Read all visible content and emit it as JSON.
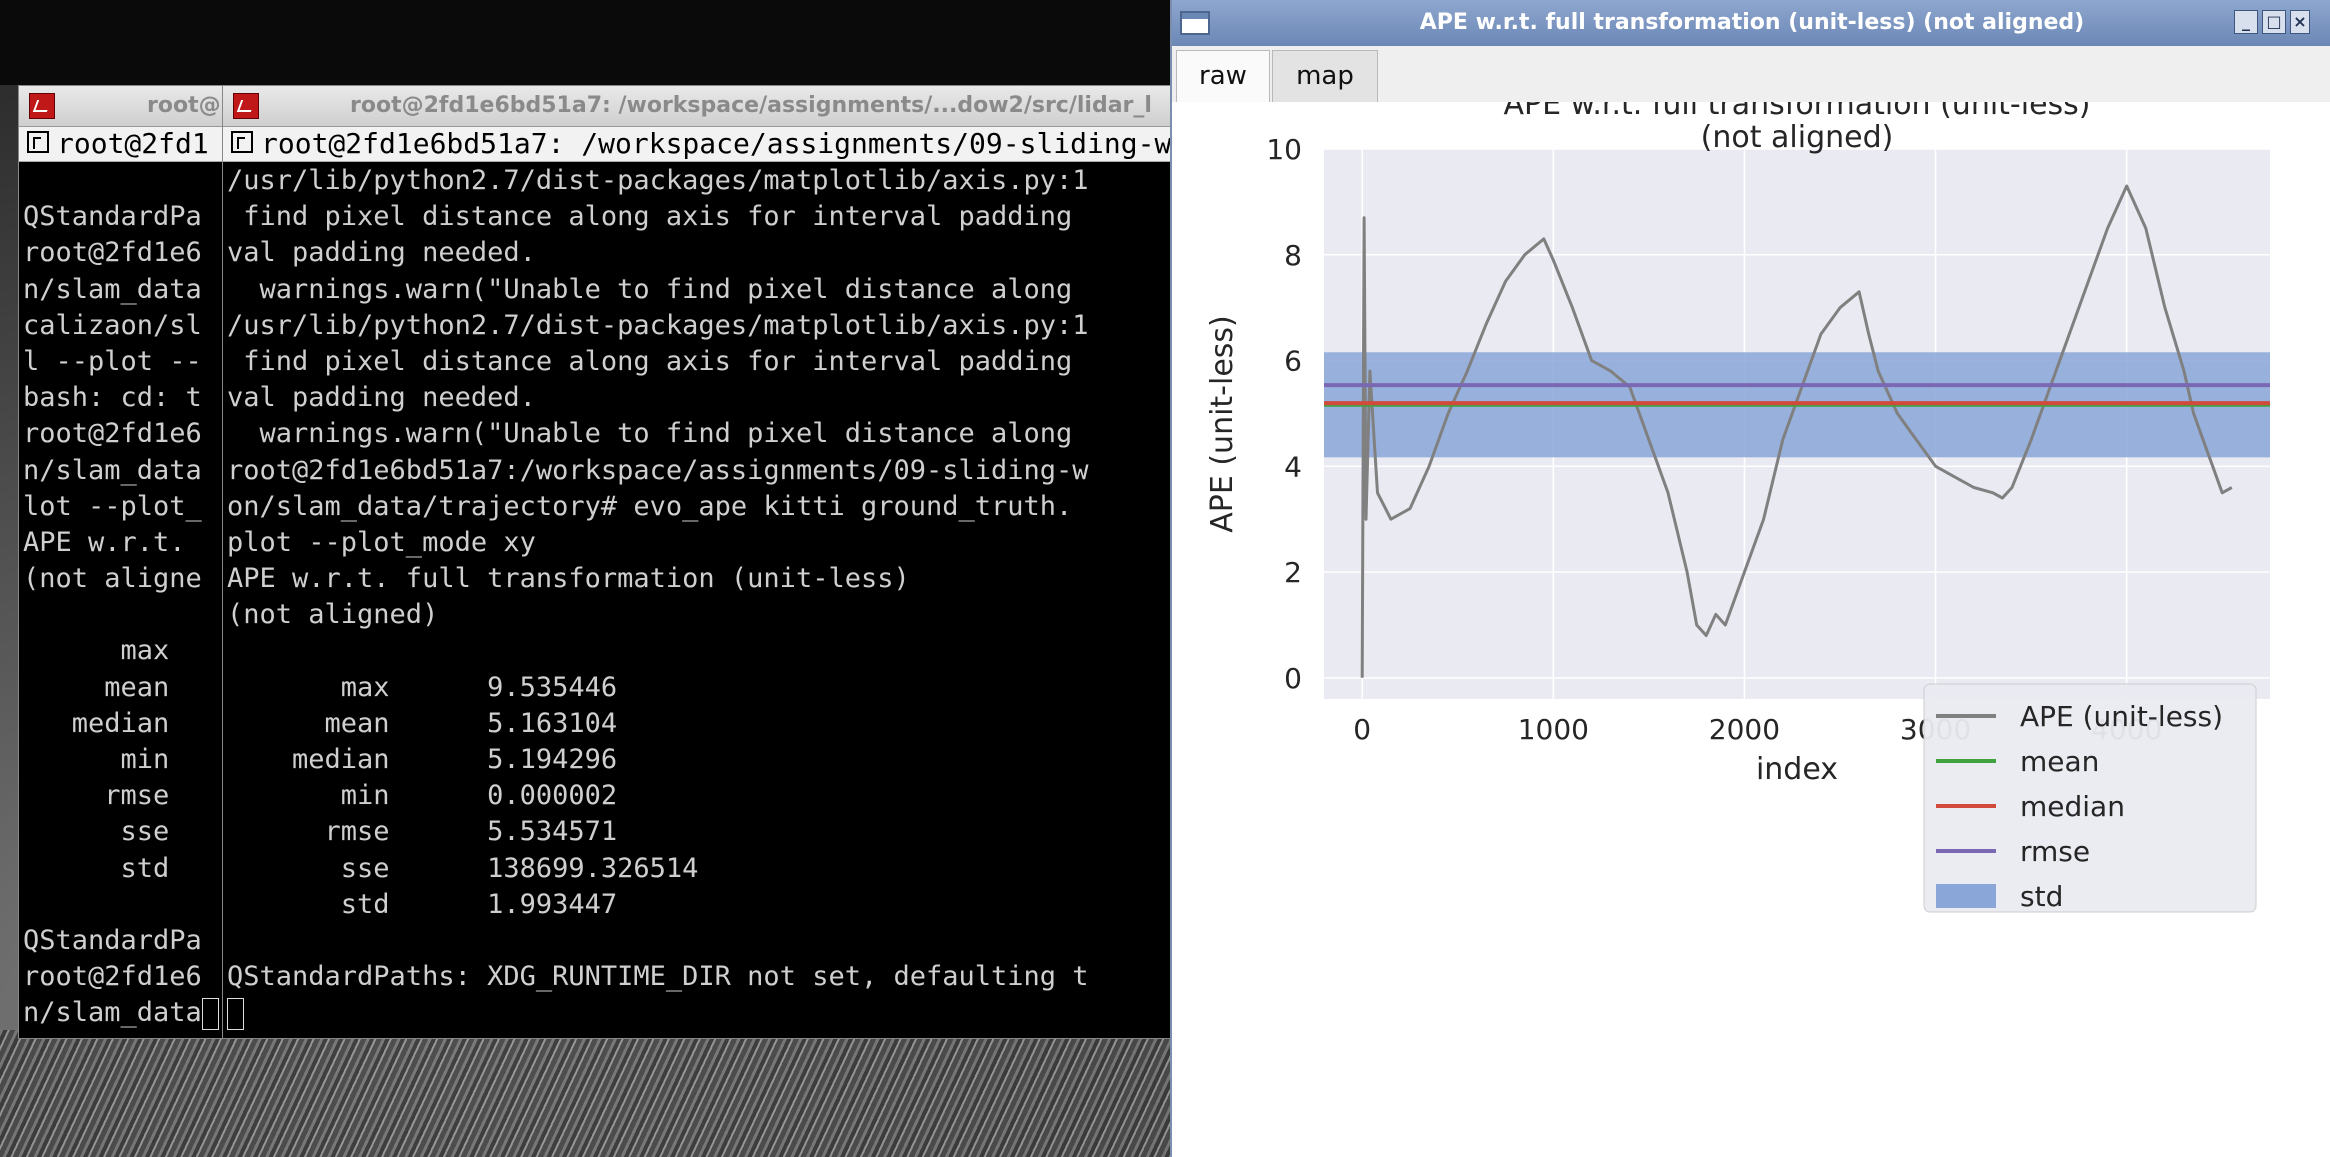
{
  "terminal_back": {
    "title": "root@",
    "tab_label": "root@2fd1",
    "lines": [
      "",
      "QStandardPa",
      "root@2fd1e6",
      "n/slam_data",
      "calizaon/sl",
      "l --plot --",
      "bash: cd: t",
      "root@2fd1e6",
      "n/slam_data",
      "lot --plot_",
      "APE w.r.t.",
      "(not aligne",
      "",
      "      max",
      "     mean",
      "   median",
      "      min",
      "     rmse",
      "      sse",
      "      std",
      "",
      "QStandardPa",
      "root@2fd1e6",
      "n/slam_data"
    ]
  },
  "terminal_front": {
    "title": "root@2fd1e6bd51a7: /workspace/assignments/...dow2/src/lidar_l",
    "tab_label": "root@2fd1e6bd51a7: /workspace/assignments/09-sliding-w",
    "lines": [
      "/usr/lib/python2.7/dist-packages/matplotlib/axis.py:1",
      " find pixel distance along axis for interval padding",
      "val padding needed.",
      "  warnings.warn(\"Unable to find pixel distance along",
      "/usr/lib/python2.7/dist-packages/matplotlib/axis.py:1",
      " find pixel distance along axis for interval padding",
      "val padding needed.",
      "  warnings.warn(\"Unable to find pixel distance along",
      "root@2fd1e6bd51a7:/workspace/assignments/09-sliding-w",
      "on/slam_data/trajectory# evo_ape kitti ground_truth.",
      "plot --plot_mode xy",
      "APE w.r.t. full transformation (unit-less)",
      "(not aligned)",
      "",
      "       max      9.535446",
      "      mean      5.163104",
      "    median      5.194296",
      "       min      0.000002",
      "      rmse      5.534571",
      "       sse      138699.326514",
      "       std      1.993447",
      "",
      "QStandardPaths: XDG_RUNTIME_DIR not set, defaulting t",
      ""
    ]
  },
  "plot_window": {
    "title": "APE w.r.t. full transformation (unit-less) (not aligned)",
    "buttons": [
      "_",
      "□",
      "×"
    ],
    "tabs": [
      {
        "label": "raw",
        "active": true
      },
      {
        "label": "map",
        "active": false
      }
    ]
  },
  "chart_data": {
    "type": "line",
    "title": "APE w.r.t. full transformation (unit-less)",
    "subtitle": "(not aligned)",
    "xlabel": "index",
    "ylabel": "APE (unit-less)",
    "xlim": [
      -200,
      4750
    ],
    "ylim": [
      -0.4,
      10
    ],
    "xticks": [
      0,
      1000,
      2000,
      3000,
      4000
    ],
    "yticks": [
      0,
      2,
      4,
      6,
      8,
      10
    ],
    "grid": true,
    "legend_position": "lower-right",
    "series": [
      {
        "name": "APE (unit-less)",
        "color": "#808080",
        "x": [
          0,
          10,
          20,
          40,
          80,
          150,
          250,
          350,
          450,
          550,
          650,
          750,
          850,
          950,
          1000,
          1100,
          1200,
          1300,
          1400,
          1500,
          1600,
          1700,
          1750,
          1800,
          1850,
          1900,
          1950,
          2000,
          2100,
          2200,
          2300,
          2400,
          2500,
          2600,
          2650,
          2700,
          2800,
          2900,
          3000,
          3100,
          3200,
          3300,
          3350,
          3400,
          3500,
          3600,
          3700,
          3800,
          3900,
          4000,
          4100,
          4200,
          4300,
          4350,
          4400,
          4450,
          4500,
          4550
        ],
        "y": [
          0.0,
          8.7,
          3.0,
          5.8,
          3.5,
          3.0,
          3.2,
          4.0,
          5.0,
          5.8,
          6.7,
          7.5,
          8.0,
          8.3,
          7.9,
          7.0,
          6.0,
          5.8,
          5.5,
          4.5,
          3.5,
          2.0,
          1.0,
          0.8,
          1.2,
          1.0,
          1.5,
          2.0,
          3.0,
          4.5,
          5.5,
          6.5,
          7.0,
          7.3,
          6.5,
          5.8,
          5.0,
          4.5,
          4.0,
          3.8,
          3.6,
          3.5,
          3.4,
          3.6,
          4.5,
          5.5,
          6.5,
          7.5,
          8.5,
          9.3,
          8.5,
          7.0,
          5.8,
          5.0,
          4.5,
          4.0,
          3.5,
          3.6
        ]
      },
      {
        "name": "mean",
        "color": "#3ea33e",
        "value": 5.163104
      },
      {
        "name": "median",
        "color": "#d04b3c",
        "value": 5.194296
      },
      {
        "name": "rmse",
        "color": "#7a68b5",
        "value": 5.534571
      },
      {
        "name": "std",
        "color": "#8aa6d8",
        "band": [
          4.169657,
          6.156551
        ]
      }
    ]
  }
}
